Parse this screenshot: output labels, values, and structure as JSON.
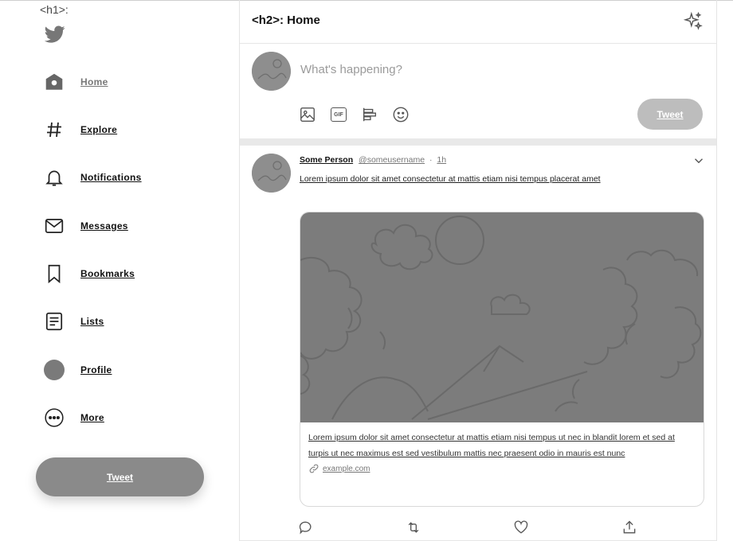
{
  "sidebar": {
    "h1_tag": "<h1>:",
    "items": [
      {
        "label": "Home",
        "icon": "home-icon"
      },
      {
        "label": "Explore",
        "icon": "hashtag-icon"
      },
      {
        "label": "Notifications",
        "icon": "bell-icon"
      },
      {
        "label": "Messages",
        "icon": "mail-icon"
      },
      {
        "label": "Bookmarks",
        "icon": "bookmark-icon"
      },
      {
        "label": "Lists",
        "icon": "list-icon"
      },
      {
        "label": "Profile",
        "icon": "avatar-icon"
      },
      {
        "label": "More",
        "icon": "more-icon"
      }
    ],
    "tweet_button": "Tweet"
  },
  "header": {
    "title": "<h2>: Home"
  },
  "composer": {
    "placeholder": "What's happening?",
    "submit_label": "Tweet"
  },
  "tweet": {
    "name": "Some Person",
    "handle": "@someusername",
    "separator": "·",
    "time": "1h",
    "text": "Lorem ipsum dolor sit amet consectetur at mattis etiam nisi tempus placerat amet",
    "card": {
      "description": "Lorem ipsum dolor sit amet consectetur at mattis etiam nisi tempus ut nec in blandit lorem et sed at turpis ut nec maximus est sed vestibulum mattis nec praesent odio in mauris est nunc",
      "link": "example.com"
    }
  },
  "colors": {
    "primary_button": "#8a8a8a",
    "disabled_button": "#bdbdbd",
    "media_bg": "#7c7c7c"
  }
}
